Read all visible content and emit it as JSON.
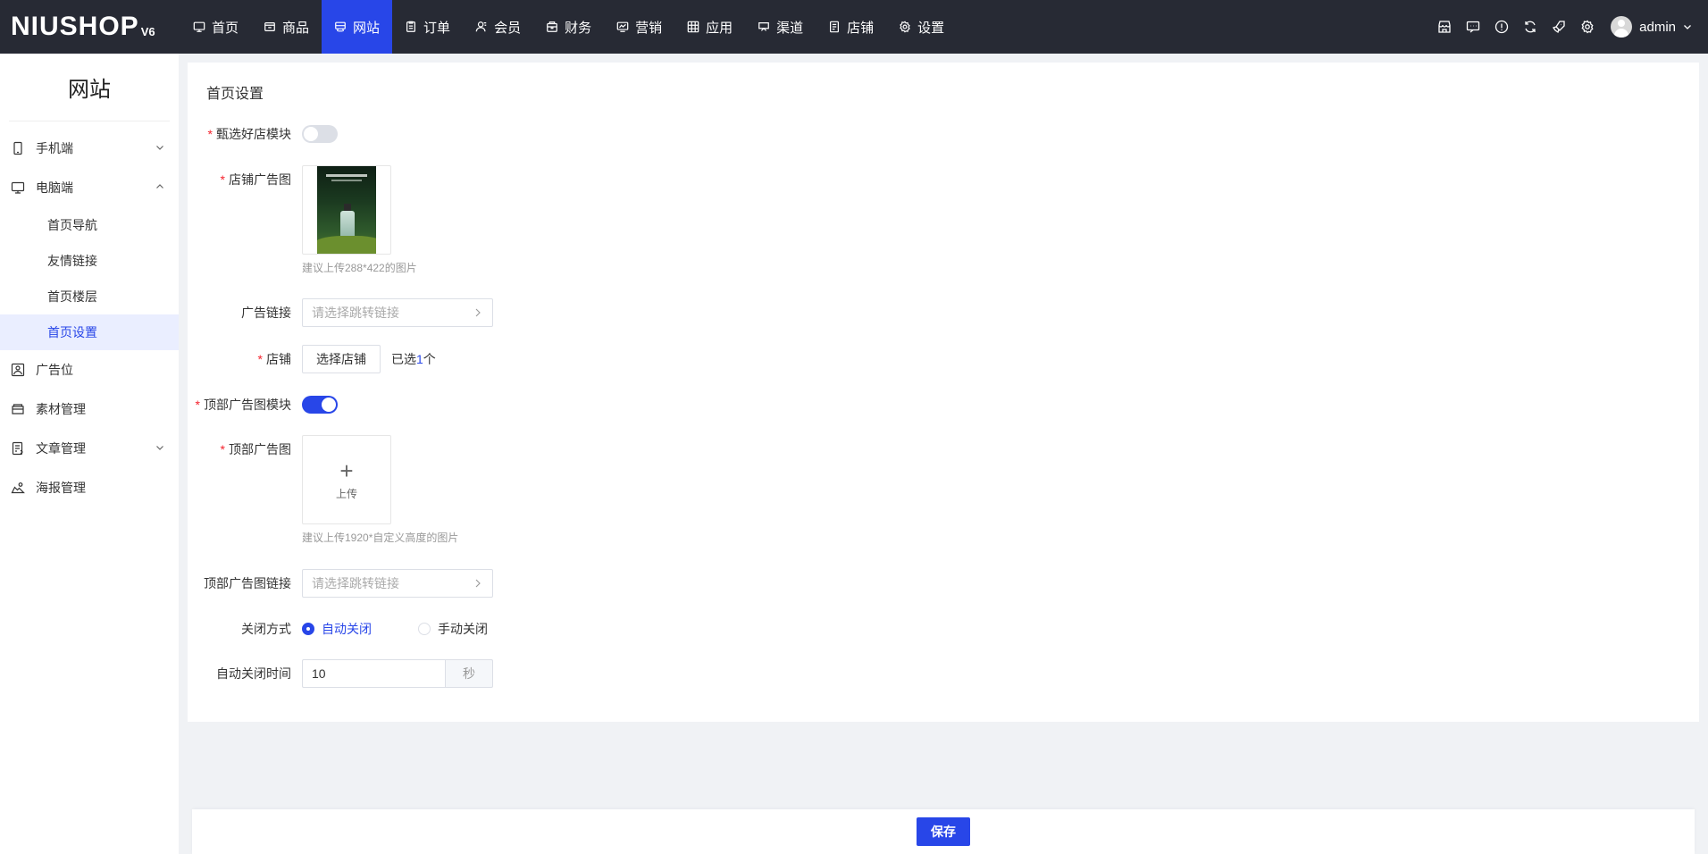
{
  "app": {
    "brand": "NIUSHOP",
    "version": "V6"
  },
  "topnav": [
    {
      "label": "首页",
      "icon": "monitor-icon",
      "active": false
    },
    {
      "label": "商品",
      "icon": "box-icon",
      "active": false
    },
    {
      "label": "网站",
      "icon": "website-icon",
      "active": true
    },
    {
      "label": "订单",
      "icon": "order-icon",
      "active": false
    },
    {
      "label": "会员",
      "icon": "member-icon",
      "active": false
    },
    {
      "label": "财务",
      "icon": "finance-icon",
      "active": false
    },
    {
      "label": "营销",
      "icon": "marketing-icon",
      "active": false
    },
    {
      "label": "应用",
      "icon": "apps-icon",
      "active": false
    },
    {
      "label": "渠道",
      "icon": "channel-icon",
      "active": false
    },
    {
      "label": "店铺",
      "icon": "shop-icon",
      "active": false
    },
    {
      "label": "设置",
      "icon": "gear-icon",
      "active": false
    }
  ],
  "user": {
    "name": "admin"
  },
  "sidebar": {
    "title": "网站",
    "items": [
      {
        "label": "手机端",
        "icon": "mobile-icon"
      },
      {
        "label": "电脑端",
        "icon": "desktop-icon"
      },
      {
        "label": "广告位",
        "icon": "image-icon"
      },
      {
        "label": "素材管理",
        "icon": "folder-icon"
      },
      {
        "label": "文章管理",
        "icon": "article-icon"
      },
      {
        "label": "海报管理",
        "icon": "poster-icon"
      }
    ],
    "pc_children": [
      {
        "label": "首页导航",
        "active": false
      },
      {
        "label": "友情链接",
        "active": false
      },
      {
        "label": "首页楼层",
        "active": false
      },
      {
        "label": "首页设置",
        "active": true
      }
    ]
  },
  "form": {
    "title": "首页设置",
    "shop_module_label": "甄选好店模块",
    "shop_module_on": false,
    "shop_ad_label": "店铺广告图",
    "shop_ad_hint": "建议上传288*422的图片",
    "shop_ad_thumb": "ad-image",
    "ad_link_label": "广告链接",
    "ad_link_placeholder": "请选择跳转链接",
    "shop_label": "店铺",
    "select_shop_btn": "选择店铺",
    "selected_prefix": "已选",
    "selected_count": "1",
    "selected_suffix": "个",
    "top_ad_module_label": "顶部广告图模块",
    "top_ad_module_on": true,
    "top_ad_label": "顶部广告图",
    "upload_label": "上传",
    "top_ad_hint": "建议上传1920*自定义高度的图片",
    "top_ad_link_label": "顶部广告图链接",
    "top_ad_link_placeholder": "请选择跳转链接",
    "close_mode_label": "关闭方式",
    "close_auto": "自动关闭",
    "close_manual": "手动关闭",
    "close_selected": "auto",
    "auto_close_time_label": "自动关闭时间",
    "auto_close_time": "10",
    "auto_close_unit": "秒"
  },
  "footer": {
    "save_label": "保存"
  },
  "colors": {
    "accent": "#2846e8",
    "topbar": "#272a34",
    "required": "#f5222d"
  }
}
